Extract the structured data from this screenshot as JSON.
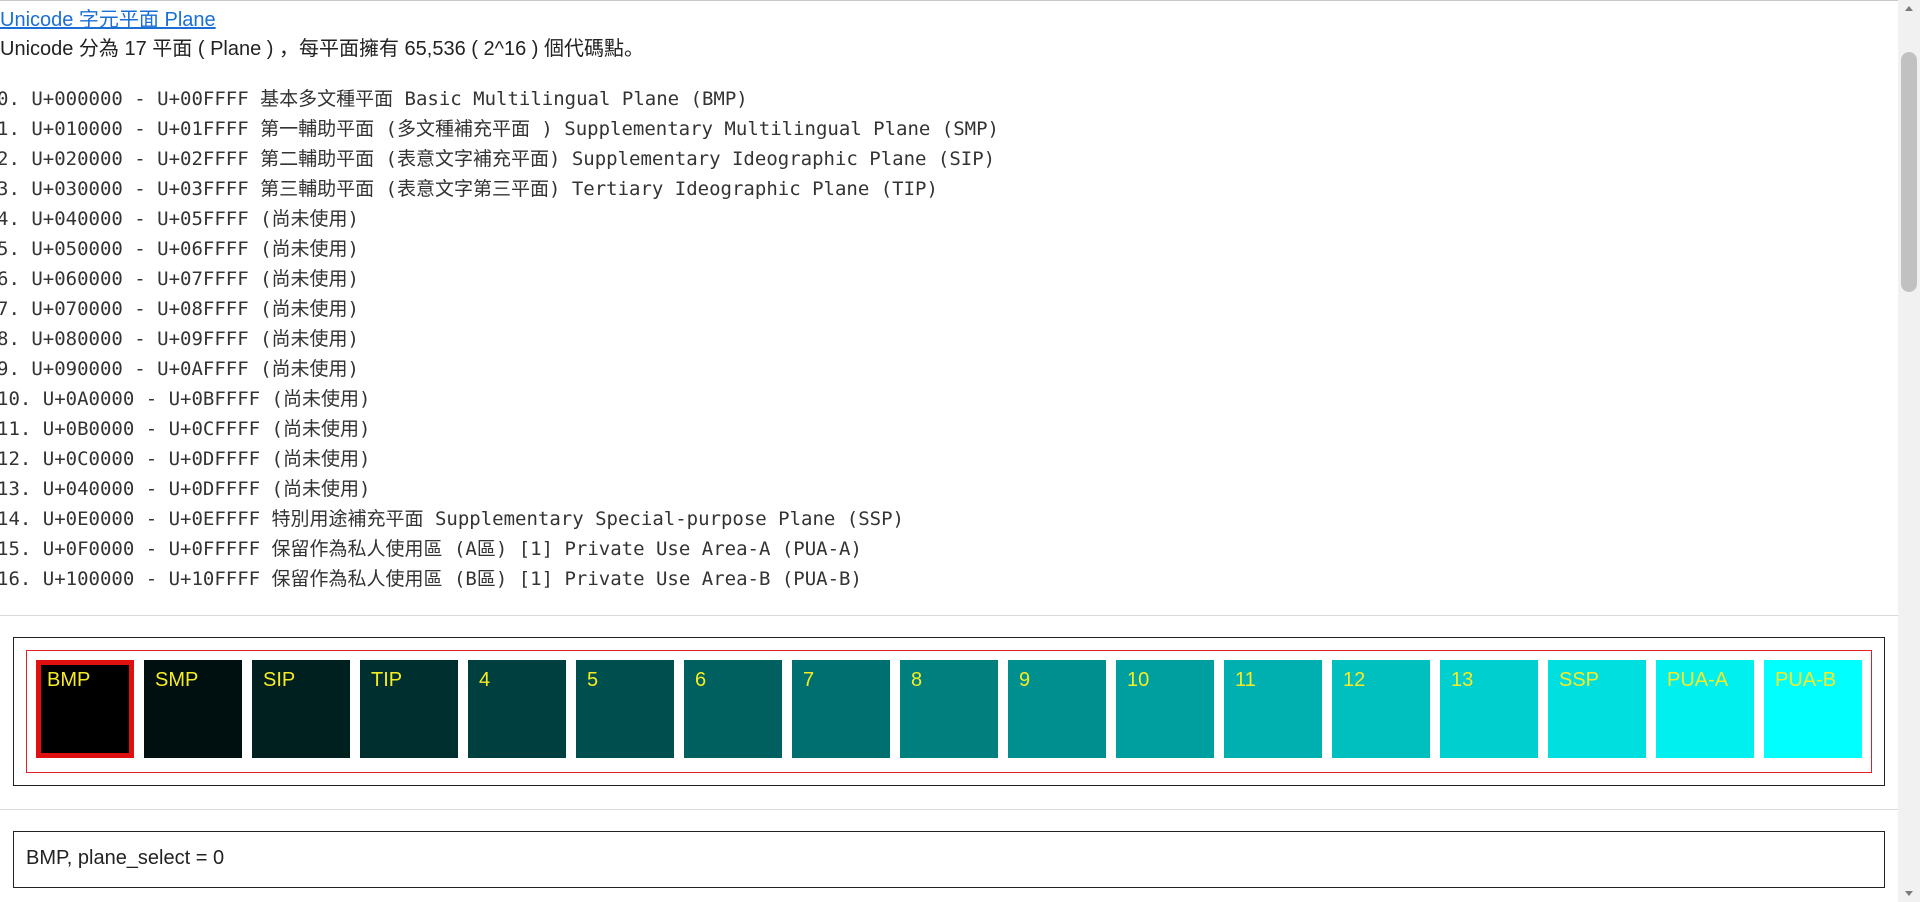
{
  "header": {
    "link_text": "Unicode 字元平面 Plane",
    "intro": "Unicode 分為 17 平面 ( Plane ) ，每平面擁有 65,536 ( 2^16 ) 個代碼點。"
  },
  "plane_list": [
    "0. U+000000 - U+00FFFF 基本多文種平面 Basic Multilingual Plane (BMP)",
    "1. U+010000 - U+01FFFF 第一輔助平面 (多文種補充平面 ) Supplementary Multilingual Plane (SMP)",
    "2. U+020000 - U+02FFFF 第二輔助平面 (表意文字補充平面) Supplementary Ideographic Plane (SIP)",
    "3. U+030000 - U+03FFFF 第三輔助平面 (表意文字第三平面) Tertiary Ideographic Plane (TIP)",
    "4. U+040000 - U+05FFFF (尚未使用)",
    "5. U+050000 - U+06FFFF (尚未使用)",
    "6. U+060000 - U+07FFFF (尚未使用)",
    "7. U+070000 - U+08FFFF (尚未使用)",
    "8. U+080000 - U+09FFFF (尚未使用)",
    "9. U+090000 - U+0AFFFF (尚未使用)",
    "10. U+0A0000 - U+0BFFFF (尚未使用)",
    "11. U+0B0000 - U+0CFFFF (尚未使用)",
    "12. U+0C0000 - U+0DFFFF (尚未使用)",
    "13. U+040000 - U+0DFFFF (尚未使用)",
    "14. U+0E0000 - U+0EFFFF 特別用途補充平面 Supplementary Special-purpose Plane (SSP)",
    "15. U+0F0000 - U+0FFFFF 保留作為私人使用區 (A區) [1] Private Use Area-A (PUA-A)",
    "16. U+100000 - U+10FFFF 保留作為私人使用區 (B區) [1] Private Use Area-B (PUA-B)"
  ],
  "planes": [
    {
      "label": "BMP",
      "color": "#000000",
      "selected": true
    },
    {
      "label": "SMP",
      "color": "#001010"
    },
    {
      "label": "SIP",
      "color": "#001f1f"
    },
    {
      "label": "TIP",
      "color": "#002f2f"
    },
    {
      "label": "4",
      "color": "#003f3f"
    },
    {
      "label": "5",
      "color": "#004f4f"
    },
    {
      "label": "6",
      "color": "#005f5f"
    },
    {
      "label": "7",
      "color": "#006f6f"
    },
    {
      "label": "8",
      "color": "#007f7f"
    },
    {
      "label": "9",
      "color": "#008f8f"
    },
    {
      "label": "10",
      "color": "#009f9f"
    },
    {
      "label": "11",
      "color": "#00afaf"
    },
    {
      "label": "12",
      "color": "#00bfbf"
    },
    {
      "label": "13",
      "color": "#00cfcf"
    },
    {
      "label": "SSP",
      "color": "#00dfdf"
    },
    {
      "label": "PUA-A",
      "color": "#00efef"
    },
    {
      "label": "PUA-B",
      "color": "#00ffff"
    }
  ],
  "status": {
    "text": "BMP, plane_select = 0"
  },
  "colors": {
    "link": "#1a6fd6",
    "label_text": "#f6ec24",
    "selected_border": "#e01010",
    "inner_border": "#e0202a"
  }
}
